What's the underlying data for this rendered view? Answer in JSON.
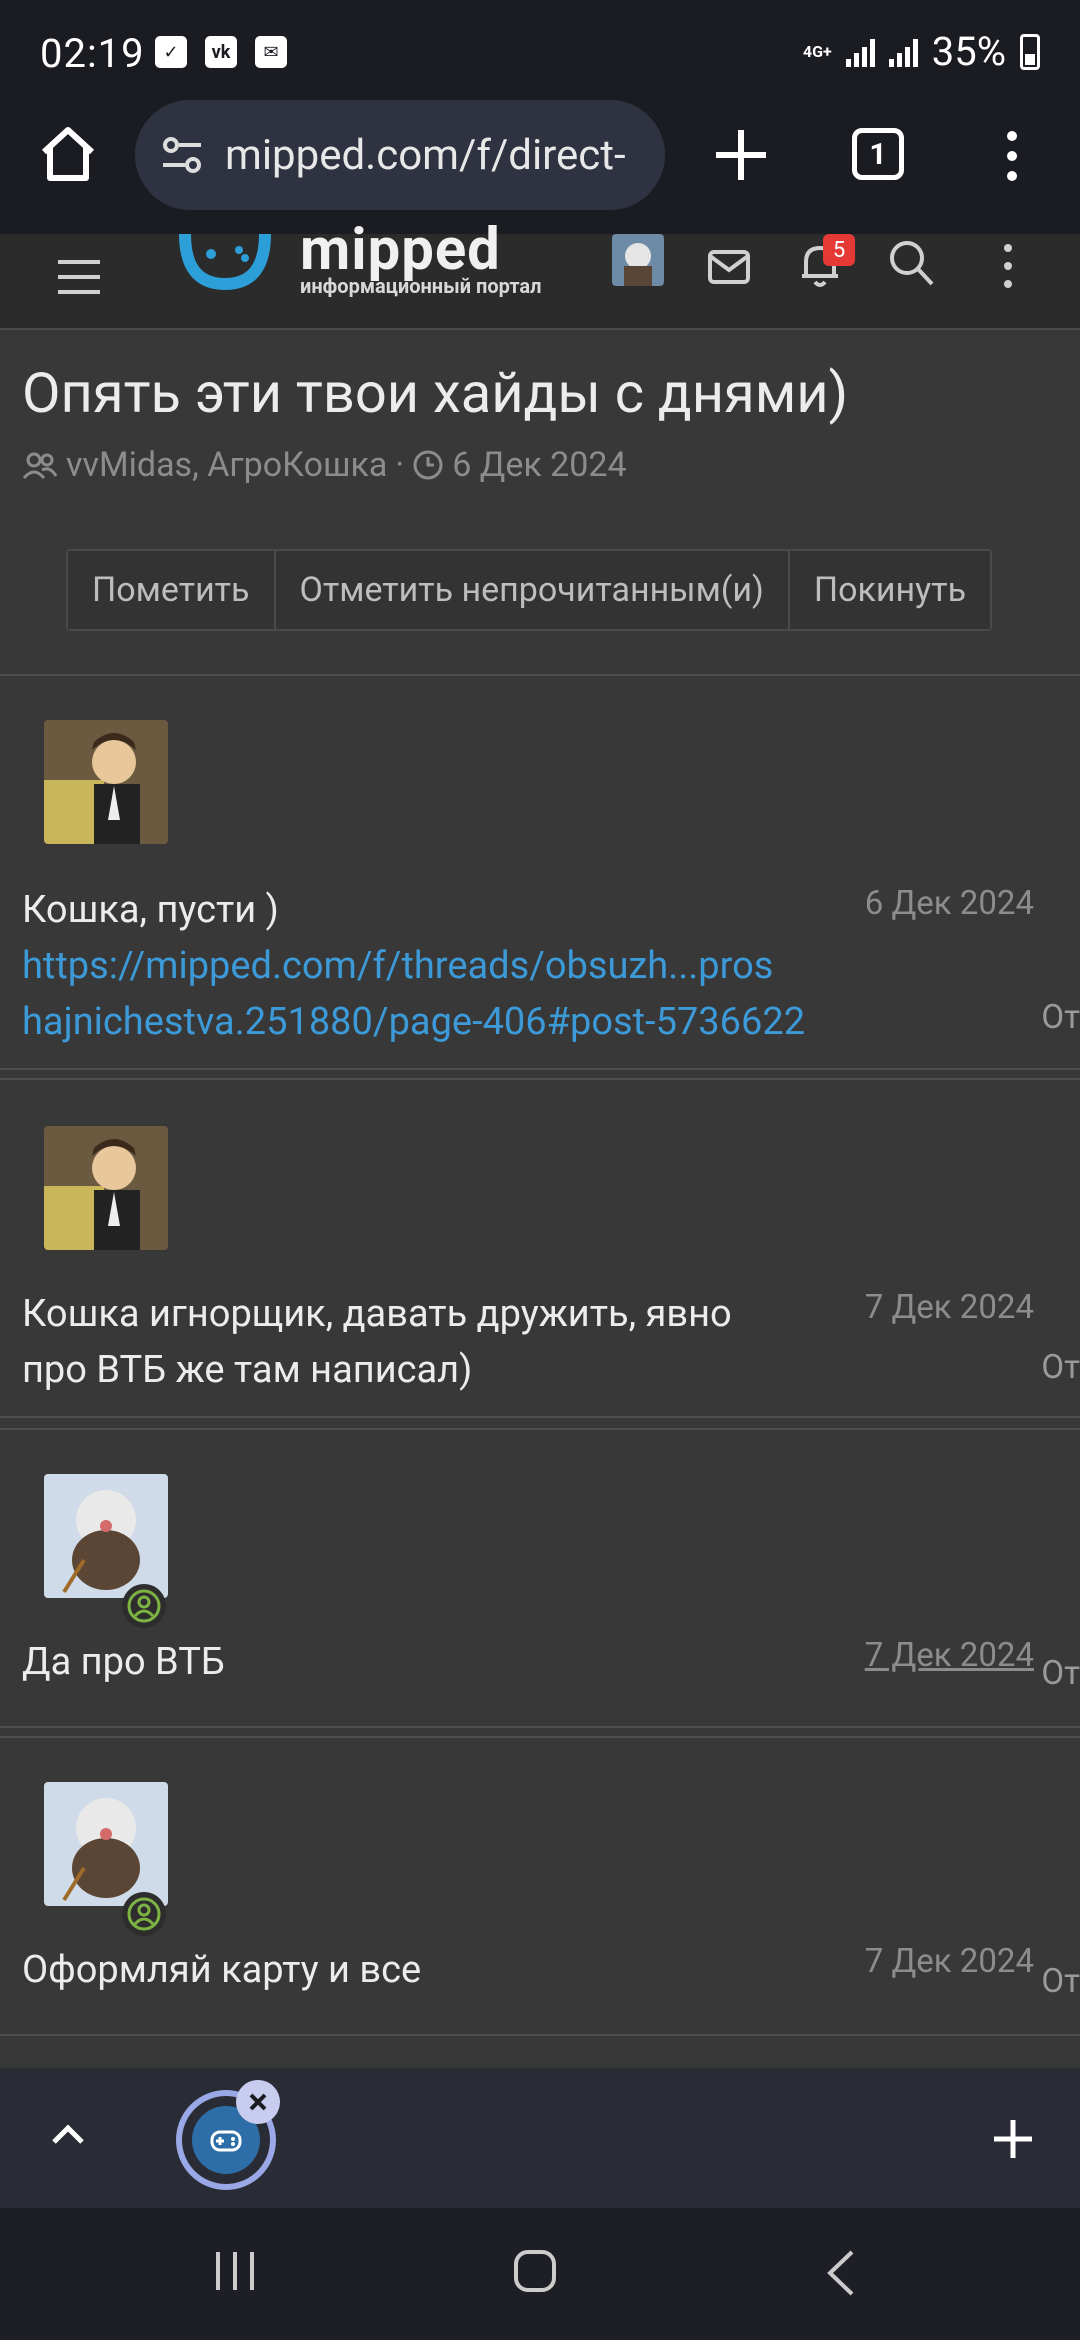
{
  "status": {
    "time": "02:19",
    "network": "4G+",
    "battery": "35%",
    "notif_icons": [
      "check-icon",
      "vk-icon",
      "mail-icon"
    ]
  },
  "browser": {
    "url": "mipped.com/f/direct-",
    "tab_count": "1"
  },
  "site": {
    "logo_title": "mipped",
    "logo_subtitle": "информационный портал",
    "notification_count": "5"
  },
  "thread": {
    "title": "Опять эти твои хайды с днями)",
    "participants": "vvMidas, АгроКошка",
    "separator": "·",
    "date": "6 Дек 2024",
    "buttons": [
      "Пометить",
      "Отметить непрочитанным(и)",
      "Покинуть"
    ]
  },
  "messages": [
    {
      "line1": "Кошка, пусти )",
      "link1": "https://mipped.com/f/threads/obsuzh...pros",
      "link2": "hajnichestva.251880/page-406#post-5736622",
      "date": "6 Дек 2024",
      "cut": "От"
    },
    {
      "line1": "Кошка игнорщик, давать дружить, явно",
      "line2": "про ВТБ же там написал)",
      "date": "7 Дек 2024",
      "cut": "От"
    },
    {
      "line1": "Да про ВТБ",
      "date": "7 Дек 2024",
      "cut": "От"
    },
    {
      "line1": "Оформляй карту и все",
      "date": "7 Дек 2024",
      "cut": "От"
    }
  ],
  "colors": {
    "page_bg": "#383838",
    "link": "#3d9ad8",
    "badge": "#e53935",
    "online": "#7cb342"
  }
}
